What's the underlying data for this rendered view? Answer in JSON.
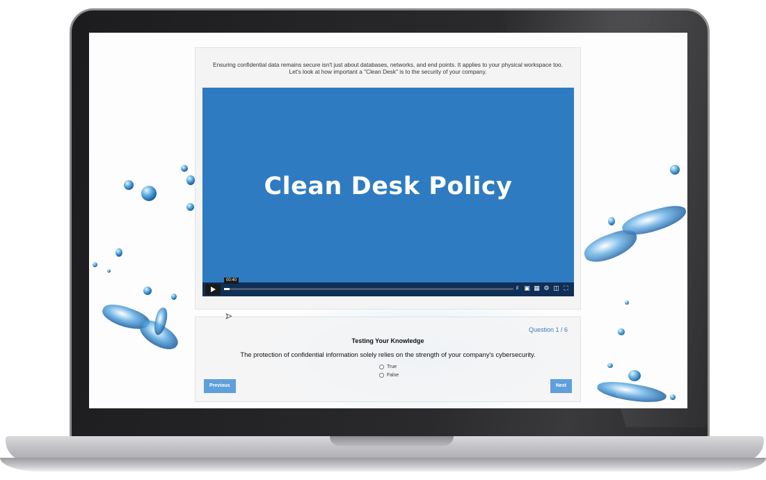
{
  "lesson": {
    "intro_line1": "Ensuring confidential data remains secure isn't just about databases, networks, and end points. It applies to your physical workspace too.",
    "intro_line2": "Let's look at how important a \"Clean Desk\" is to the security of your company."
  },
  "video": {
    "title": "Clean Desk Policy",
    "current_time": "00:40",
    "progress_percent": 2,
    "accent_color": "#2f7bc1",
    "control_icons": [
      "volume-icon",
      "captions-icon",
      "transcript-icon",
      "settings-icon",
      "picture-in-picture-icon",
      "fullscreen-icon"
    ]
  },
  "quiz": {
    "counter": "Question 1 / 6",
    "heading": "Testing Your Knowledge",
    "question": "The protection of confidential information solely relies on the strength of your company's cybersecurity.",
    "options": [
      "True",
      "False"
    ],
    "previous_label": "Previous",
    "next_label": "Next",
    "button_color": "#5f9fdb"
  }
}
